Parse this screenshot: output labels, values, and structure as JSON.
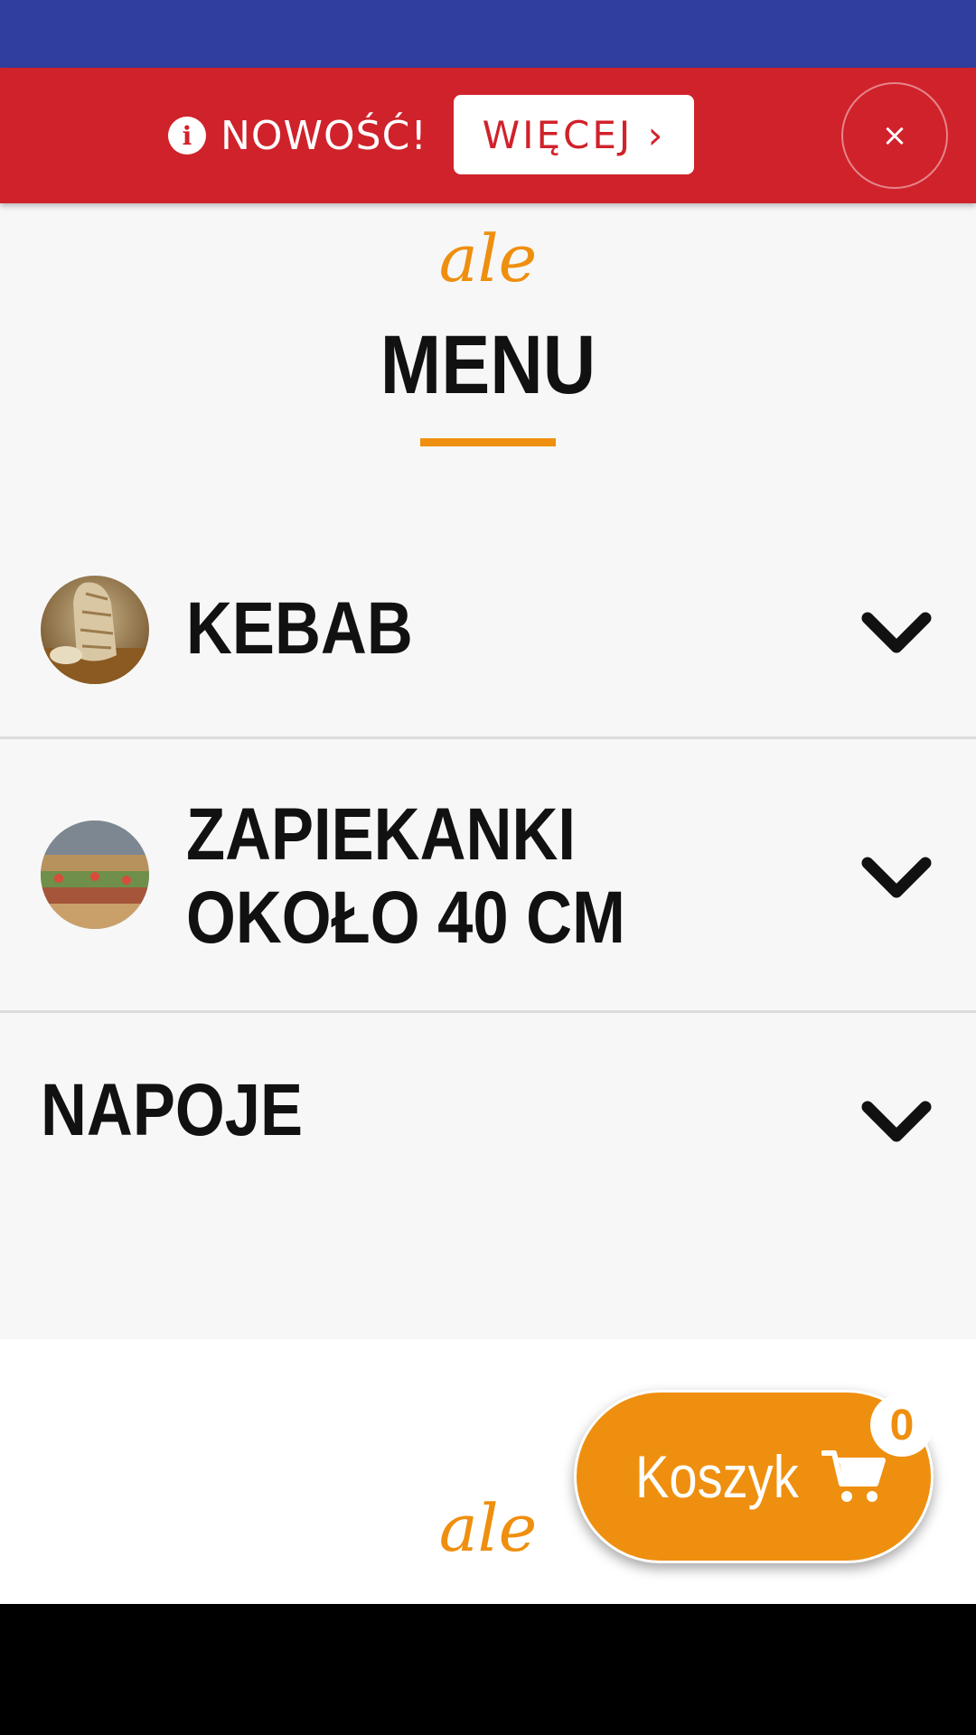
{
  "banner": {
    "news_label": "NOWOŚĆ!",
    "more_label": "WIĘCEJ ›",
    "close_label": "×",
    "info_icon": "i"
  },
  "logo_text": "ale",
  "menu_title": "MENU",
  "categories": [
    {
      "label": "KEBAB",
      "has_thumb": true
    },
    {
      "label": "ZAPIEKANKI OKOŁO 40 CM",
      "has_thumb": true
    },
    {
      "label": "NAPOJE",
      "has_thumb": false
    }
  ],
  "cart": {
    "label": "Koszyk",
    "count": "0"
  },
  "colors": {
    "status_bar": "#303f9f",
    "banner": "#d0222b",
    "accent": "#ef8f0f"
  },
  "icons": {
    "banner": "info-circle-icon",
    "close": "close-icon",
    "category_toggle": "chevron-down-icon",
    "cart": "shopping-cart-icon"
  }
}
